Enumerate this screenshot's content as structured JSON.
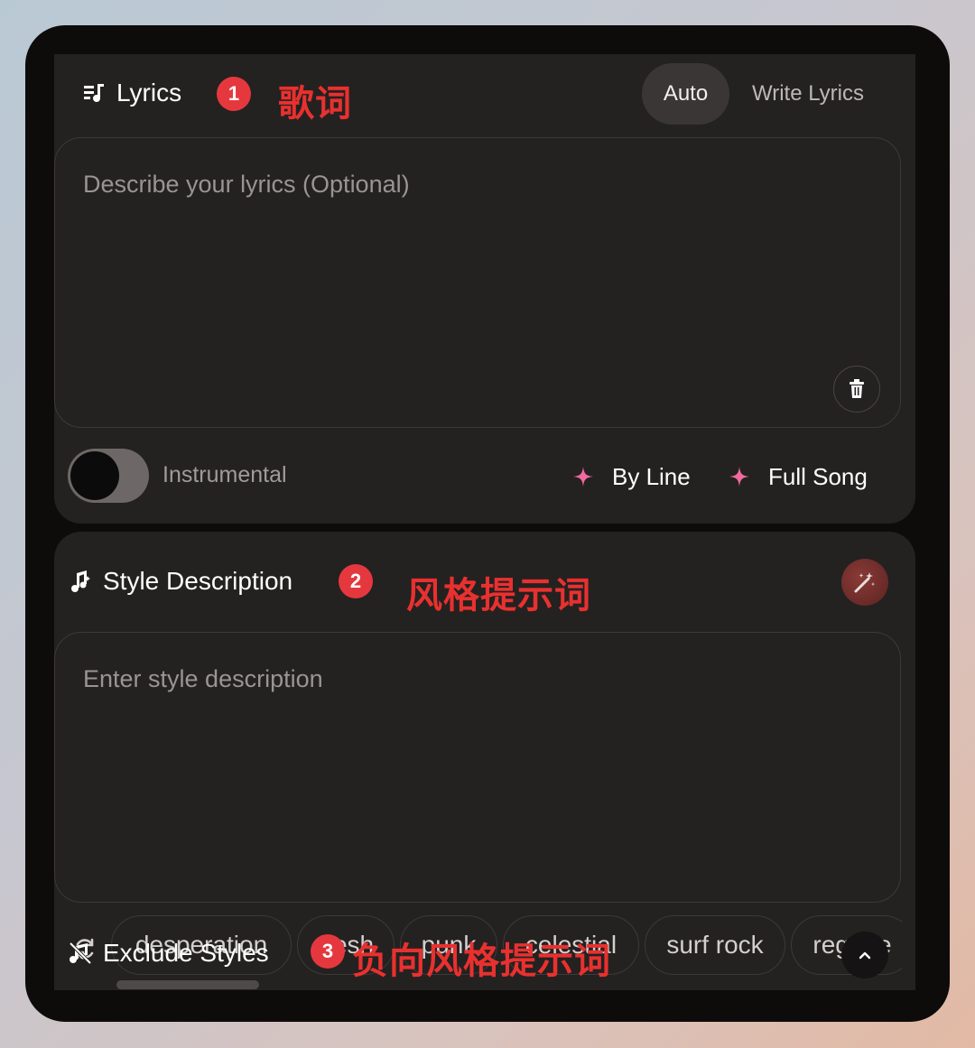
{
  "lyrics": {
    "title": "Lyrics",
    "badge": "1",
    "annotation": "歌词",
    "mode_auto": "Auto",
    "mode_write": "Write Lyrics",
    "placeholder": "Describe your lyrics (Optional)",
    "instrumental_label": "Instrumental",
    "instrumental_on": false,
    "by_line_label": "By Line",
    "full_song_label": "Full Song"
  },
  "style": {
    "title": "Style Description",
    "badge": "2",
    "annotation": "风格提示词",
    "placeholder": "Enter style description",
    "chips": [
      "desperation",
      "fresh",
      "punk",
      "celestial",
      "surf rock",
      "reggae"
    ]
  },
  "exclude": {
    "title": "Exclude Styles",
    "badge": "3",
    "annotation": "负向风格提示词"
  },
  "colors": {
    "badge": "#e5383e",
    "annotation": "#e8312f",
    "sparkle": "#f06aa0",
    "panel": "#242121"
  }
}
